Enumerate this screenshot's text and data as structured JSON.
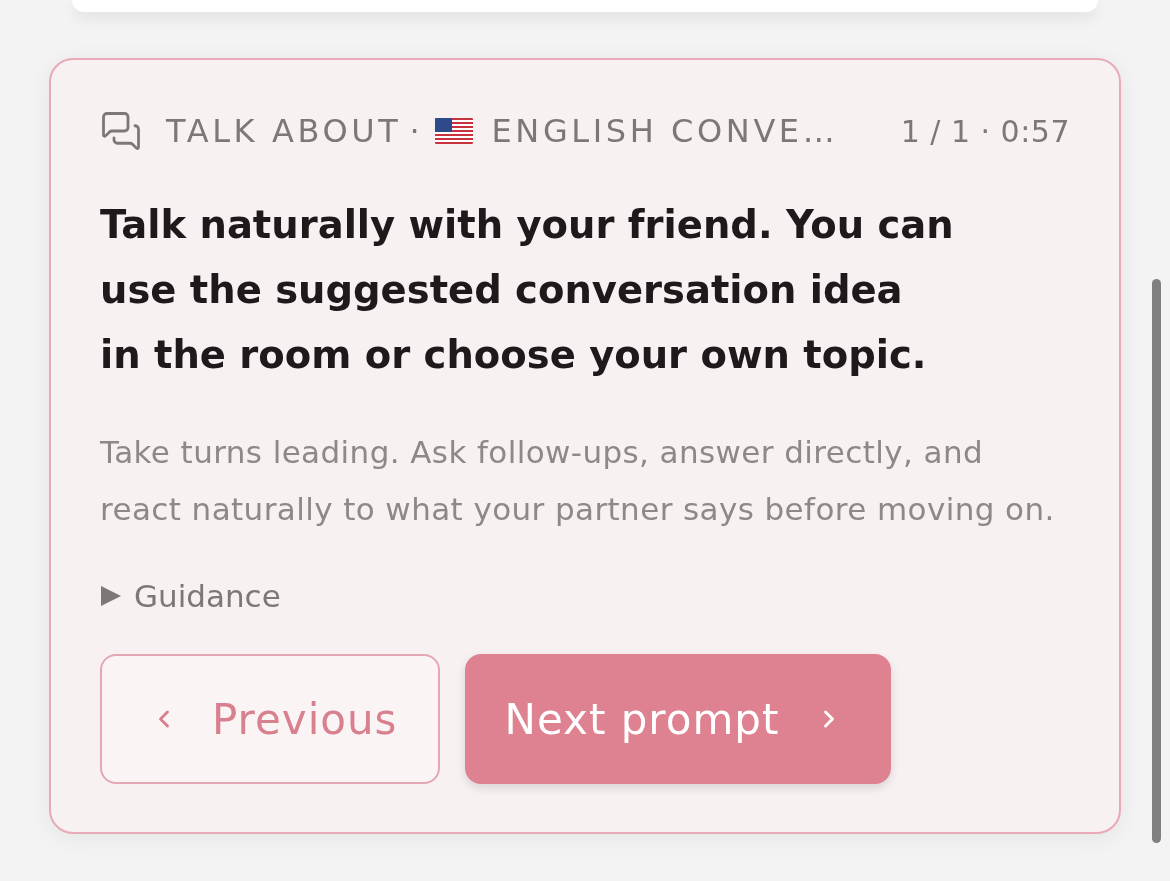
{
  "card": {
    "header": {
      "category": "TALK ABOUT",
      "separator": "·",
      "topic": "ENGLISH CONVE…",
      "progress": "1 / 1 · 0:57"
    },
    "prompt": "Talk naturally with your friend. You can use the suggested conversation idea in the room or choose your own topic.",
    "instructions": "Take turns leading. Ask follow-ups, answer directly, and react naturally to what your partner says before moving on.",
    "guidance": {
      "label": "Guidance",
      "expanded": false
    },
    "buttons": [
      {
        "kind": "secondary",
        "label": "Previous"
      },
      {
        "kind": "primary",
        "label": "Next prompt"
      }
    ]
  }
}
